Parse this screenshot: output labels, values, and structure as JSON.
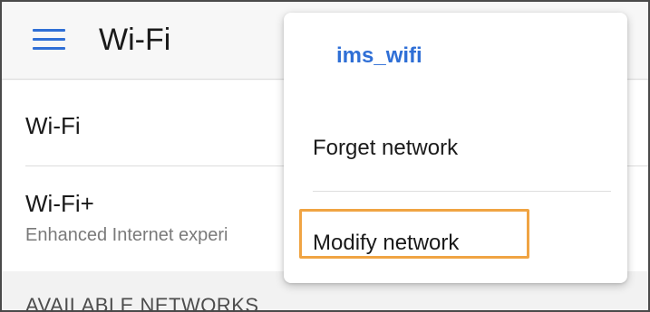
{
  "appbar": {
    "title": "Wi-Fi",
    "menu_icon": "hamburger-menu-icon"
  },
  "settings": {
    "wifi_label": "Wi-Fi",
    "wifi_plus_label": "Wi-Fi+",
    "wifi_plus_subtitle": "Enhanced Internet experi"
  },
  "section": {
    "available_networks": "AVAILABLE NETWORKS"
  },
  "popup": {
    "network_name": "ims_wifi",
    "items": [
      {
        "label": "Forget network"
      },
      {
        "label": "Modify network"
      }
    ]
  },
  "colors": {
    "accent": "#2f6fd6",
    "highlight": "#f0a443"
  }
}
